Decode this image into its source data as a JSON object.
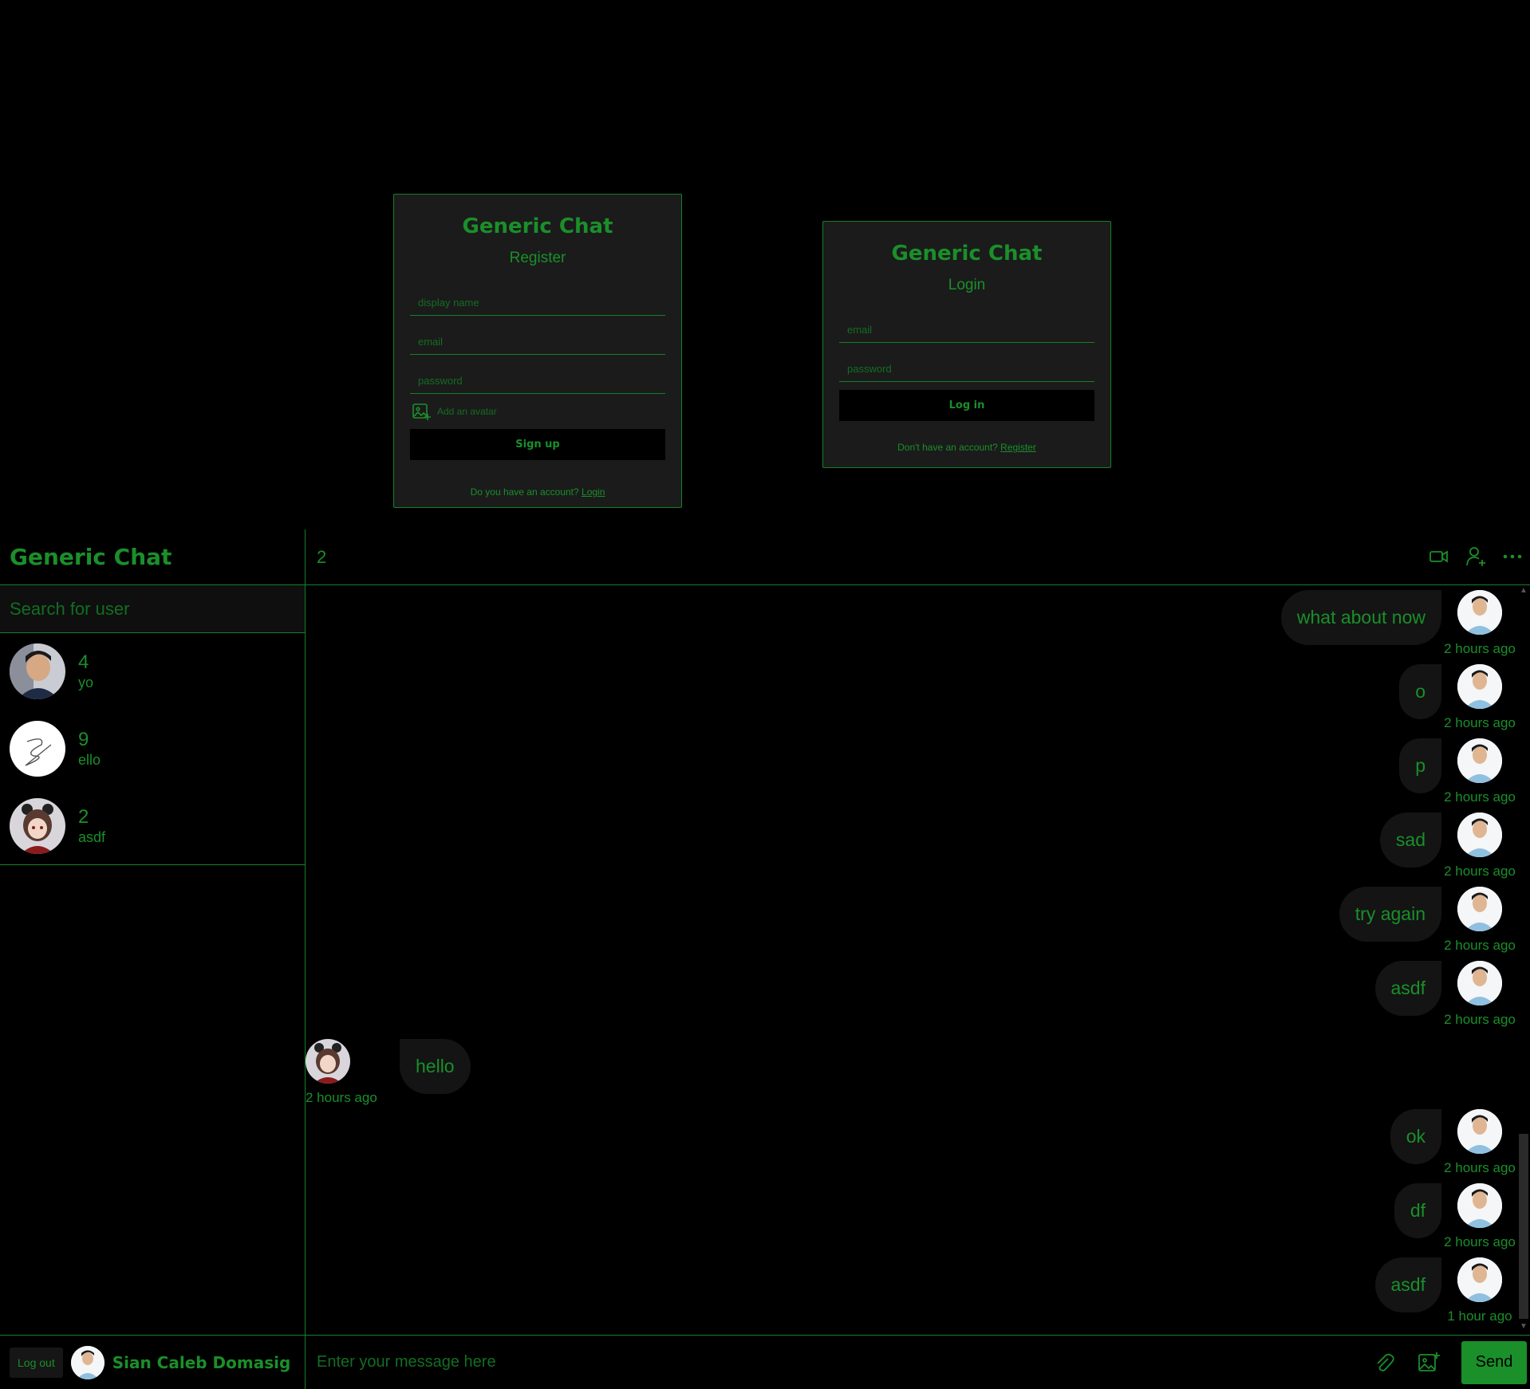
{
  "register_card": {
    "title": "Generic Chat",
    "subtitle": "Register",
    "display_name_placeholder": "display name",
    "email_placeholder": "email",
    "password_placeholder": "password",
    "avatar_label": "Add an avatar",
    "signup_label": "Sign up",
    "footer_text": "Do you have an account? ",
    "footer_link": "Login"
  },
  "login_card": {
    "title": "Generic Chat",
    "subtitle": "Login",
    "email_placeholder": "email",
    "password_placeholder": "password",
    "login_label": "Log in",
    "footer_text": "Don't have an account? ",
    "footer_link": "Register"
  },
  "sidebar": {
    "logo": "Generic Chat",
    "search_placeholder": "Search for user",
    "chats": [
      {
        "name": "4",
        "last": "yo",
        "avatar": "photo-avatar"
      },
      {
        "name": "9",
        "last": "ello",
        "avatar": "scribble-avatar"
      },
      {
        "name": "2",
        "last": "asdf",
        "avatar": "anime-avatar"
      }
    ],
    "logout_label": "Log out",
    "current_user": "Sian Caleb Domasig"
  },
  "chat": {
    "title": "2",
    "icons": [
      "video-icon",
      "add-user-icon",
      "more-icon"
    ],
    "messages": [
      {
        "text": "what about now",
        "time": "2 hours ago",
        "mine": true
      },
      {
        "text": "o",
        "time": "2 hours ago",
        "mine": true
      },
      {
        "text": "p",
        "time": "2 hours ago",
        "mine": true
      },
      {
        "text": "sad",
        "time": "2 hours ago",
        "mine": true
      },
      {
        "text": "try again",
        "time": "2 hours ago",
        "mine": true
      },
      {
        "text": "asdf",
        "time": "2 hours ago",
        "mine": true
      },
      {
        "text": "hello",
        "time": "2 hours ago",
        "mine": false
      },
      {
        "text": "ok",
        "time": "2 hours ago",
        "mine": true
      },
      {
        "text": "df",
        "time": "2 hours ago",
        "mine": true
      },
      {
        "text": "asdf",
        "time": "1 hour ago",
        "mine": true
      }
    ],
    "input_placeholder": "Enter your message here",
    "send_label": "Send"
  },
  "colors": {
    "accent": "#1a8f2a",
    "background": "#000000",
    "card": "#1b1b1b",
    "bubble": "#141414"
  }
}
